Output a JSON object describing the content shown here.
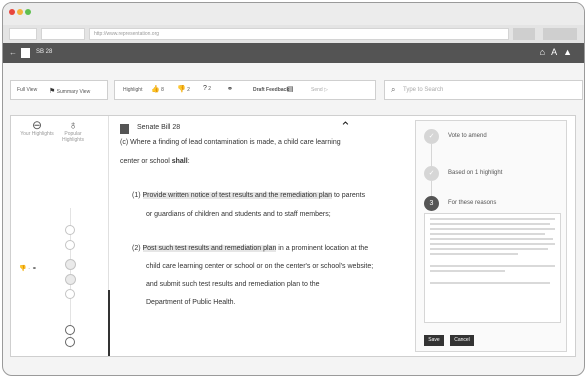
{
  "browser": {
    "url": "http://www.representation.org"
  },
  "app": {
    "title": "SB 28"
  },
  "toolbar": {
    "full_view": "Full View",
    "summary_view": "Summary View",
    "highlight": "Highlight",
    "count_a": "8",
    "count_b": "2",
    "count_c": "2",
    "draft_feedback": "Draft Feedback",
    "send": "Send",
    "search_placeholder": "Type to Search"
  },
  "rail": {
    "your": "Your Highlights",
    "popular": "Popular Highlights"
  },
  "document": {
    "title": "Senate Bill 28",
    "intro_a": "(c) Where a finding of lead contamination is made, a child care learning",
    "intro_b": "center or school ",
    "intro_shall": "shall",
    "intro_colon": ":",
    "item1_a_pre": "(1) ",
    "item1_a_hl": "Provide written notice of test results and the remediation plan",
    "item1_a_post": " to parents",
    "item1_b": "or guardians of children and students and to staff members;",
    "item2_a_pre": "(2) ",
    "item2_a_hl": "Post such test results and remediation plan",
    "item2_a_post": " in a prominent location at the",
    "item2_b": "child care learning center or school or on the center's or school's website;",
    "item2_c": "and submit such test results and remediation plan to the",
    "item2_d": "Department of Public Health."
  },
  "sidebar": {
    "step1": "Vote to amend",
    "step2": "Based on 1 highlight",
    "step3_num": "3",
    "step3": "For these reasons",
    "save": "Save",
    "cancel": "Cancel"
  }
}
